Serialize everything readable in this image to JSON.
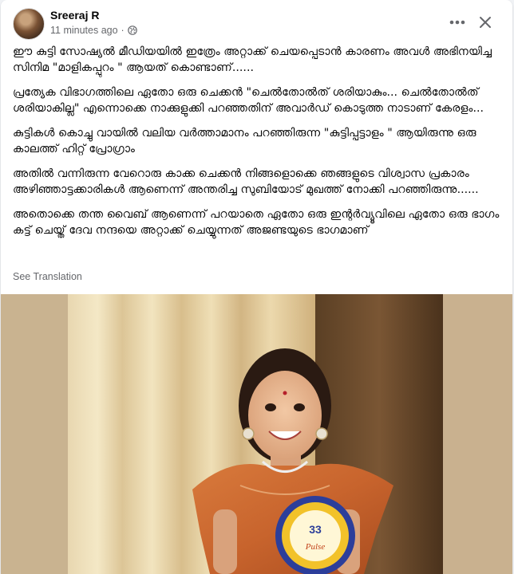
{
  "post": {
    "author": "Sreeraj R",
    "time": "11 minutes ago",
    "privacy_separator": "·",
    "paragraphs": [
      "ഈ കുട്ടി സോഷ്യൽ മീഡിയയിൽ ഇത്രേം അറ്റാക്ക് ചെയപ്പെടാൻ കാരണം അവൾ അഭിനയിച്ച സിനിമ \"മാളികപ്പുറം \" ആയത് കൊണ്ടാണ്......",
      "പ്രത്യേക വിഭാഗത്തിലെ ഏതോ ഒരു ചെക്കൻ \"ചെൽതോൽത് ശരിയാകും... ചെൽതോൽത് ശരിയാകില്ല\" എന്നൊക്കെ നാക്കുളുക്കി പറഞ്ഞതിന്  അവാർഡ് കൊടുത്ത നാടാണ് കേരളം...",
      "കുട്ടികൾ കൊച്ചു വായിൽ വലിയ വർത്താമാനം പറഞ്ഞിരുന്ന \"കുട്ടിപ്പട്ടാളം \" ആയിരുന്നു ഒരു കാലത്ത് ഹിറ്റ് പ്രോഗ്രാം",
      "അതിൽ വന്നിരുന്ന വേറൊരു കാക്ക ചെക്കൻ  നിങ്ങളൊക്കെ ഞങ്ങളുടെ വിശ്വാസ പ്രകാരം അഴിഞ്ഞാട്ടക്കാരികൾ ആണെന്ന് അന്തരിച്ച സുബിയോട് മുഖത്ത് നോക്കി പറഞ്ഞിരുന്നു......",
      "അതൊക്കെ തന്ത വൈബ് ആണെന്ന് പറയാതെ ഏതോ ഒരു ഇന്റർവ്യൂവിലെ ഏതോ ഒരു ഭാഗം കട്ട് ചെയ്ത് ദേവ നന്ദയെ അറ്റാക്ക് ചെയ്യുന്നത് അജണ്ടയുടെ ഭാഗമാണ്"
    ],
    "see_translation": "See Translation",
    "more_icon": "more-horizontal-icon",
    "close_icon": "close-icon",
    "privacy_icon": "globe-icon"
  },
  "photo": {
    "badge_number": "33",
    "badge_text": "Pulse"
  },
  "colors": {
    "text": "#050505",
    "secondary": "#65676b",
    "background": "#f0f2f5",
    "dress": "#c8642d"
  }
}
